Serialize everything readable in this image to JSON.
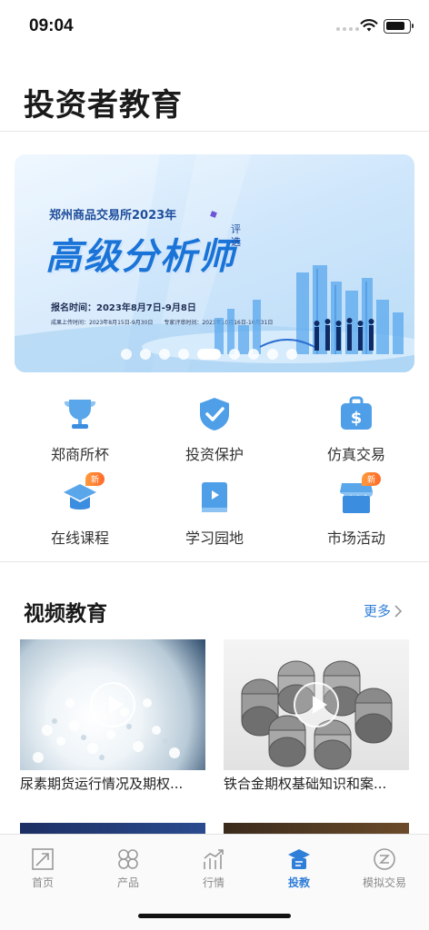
{
  "status": {
    "time": "09:04"
  },
  "page": {
    "title": "投资者教育"
  },
  "banner": {
    "org": "郑州商品交易所2023年",
    "headline": "高级分析师",
    "tag": "评选",
    "signup": "报名时间：2023年8月7日-9月8日",
    "schedule": "成果上传时间：2023年8月15日-9月30日　　专家评审时间：2023年10月16日-10月31日",
    "page_count": 9,
    "active_index": 4,
    "colors": {
      "headline": "#1a74d8",
      "bg": "#cfe6fb"
    }
  },
  "quick_entries": [
    {
      "label": "郑商所杯",
      "icon": "trophy-icon",
      "badge": ""
    },
    {
      "label": "投资保护",
      "icon": "shield-check-icon",
      "badge": ""
    },
    {
      "label": "仿真交易",
      "icon": "dollar-bag-icon",
      "badge": ""
    },
    {
      "label": "在线课程",
      "icon": "graduation-cap-icon",
      "badge": "新"
    },
    {
      "label": "学习园地",
      "icon": "book-play-icon",
      "badge": ""
    },
    {
      "label": "市场活动",
      "icon": "shop-icon",
      "badge": "新"
    }
  ],
  "video_section": {
    "title": "视频教育",
    "more": "更多",
    "videos": [
      {
        "title": "尿素期货运行情况及期权..."
      },
      {
        "title": "铁合金期权基础知识和案..."
      }
    ]
  },
  "tabbar": {
    "items": [
      {
        "label": "首页",
        "icon": "home-arrow-icon"
      },
      {
        "label": "产品",
        "icon": "product-grid-icon"
      },
      {
        "label": "行情",
        "icon": "chart-icon"
      },
      {
        "label": "投教",
        "icon": "education-icon"
      },
      {
        "label": "模拟交易",
        "icon": "simulate-trade-icon"
      }
    ],
    "active": "投教",
    "colors": {
      "active": "#2f7ed8",
      "inactive": "#8a8a8a"
    }
  }
}
